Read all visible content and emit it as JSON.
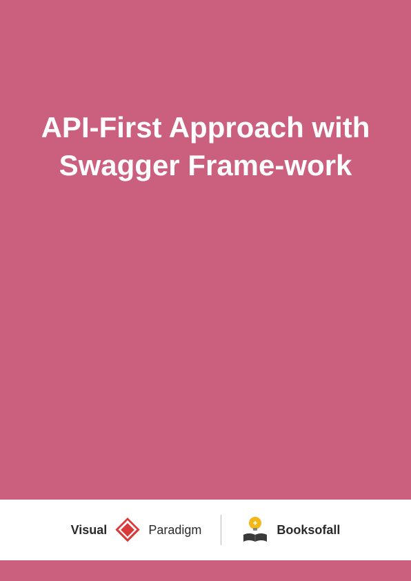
{
  "cover": {
    "title": "API-First Approach with Swagger Frame-work"
  },
  "footer": {
    "logo1": {
      "text_bold": "Visual",
      "text_normal": "Paradigm"
    },
    "logo2": {
      "text": "Booksofall"
    }
  },
  "colors": {
    "background": "#ca5f7e",
    "text": "#ffffff",
    "footer_bg": "#ffffff",
    "logo_text": "#2a2a2a"
  }
}
